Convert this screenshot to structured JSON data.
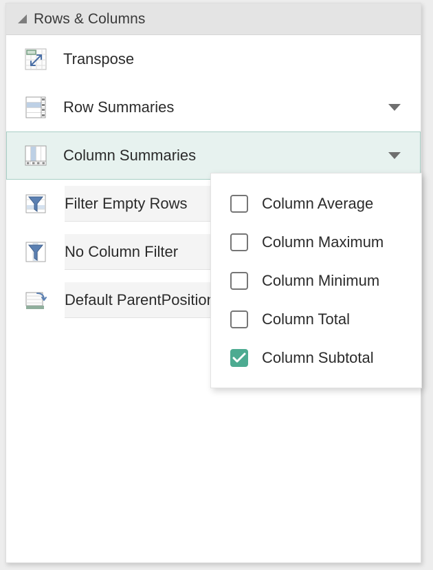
{
  "section": {
    "title": "Rows & Columns",
    "collapse_icon": "triangle-collapse-icon",
    "expanded": true,
    "header_bg": "#e4e4e4"
  },
  "theme": {
    "panel_bg": "#ffffff",
    "page_bg": "#ededed",
    "selected_bg": "#e7f2ef",
    "selected_border": "#a8cfc5",
    "accent": "#4dab91",
    "field_bg": "#f4f4f4",
    "text": "#2b2b2b"
  },
  "rows": [
    {
      "label": "Transpose",
      "icon": "transpose-icon",
      "has_arrow": false,
      "selected": false,
      "field": false
    },
    {
      "label": "Row Summaries",
      "icon": "row-summaries-icon",
      "has_arrow": true,
      "arrow_icon": "chevron-down-icon",
      "selected": false,
      "field": false
    },
    {
      "label": "Column Summaries",
      "icon": "column-summaries-icon",
      "has_arrow": true,
      "arrow_icon": "chevron-down-icon",
      "selected": true,
      "field": false
    },
    {
      "label": "Filter Empty Rows",
      "icon": "filter-empty-rows-icon",
      "has_arrow": false,
      "selected": false,
      "field": true
    },
    {
      "label": "No Column Filter",
      "icon": "no-column-filter-icon",
      "has_arrow": false,
      "selected": false,
      "field": true
    },
    {
      "label": "Default ParentPosition",
      "icon": "default-parent-position-icon",
      "has_arrow": false,
      "selected": false,
      "field": true
    }
  ],
  "dropdown": {
    "open": true,
    "owner": "Column Summaries",
    "items": [
      {
        "label": "Column Average",
        "checked": false
      },
      {
        "label": "Column Maximum",
        "checked": false
      },
      {
        "label": "Column Minimum",
        "checked": false
      },
      {
        "label": "Column Total",
        "checked": false
      },
      {
        "label": "Column Subtotal",
        "checked": true
      }
    ]
  }
}
